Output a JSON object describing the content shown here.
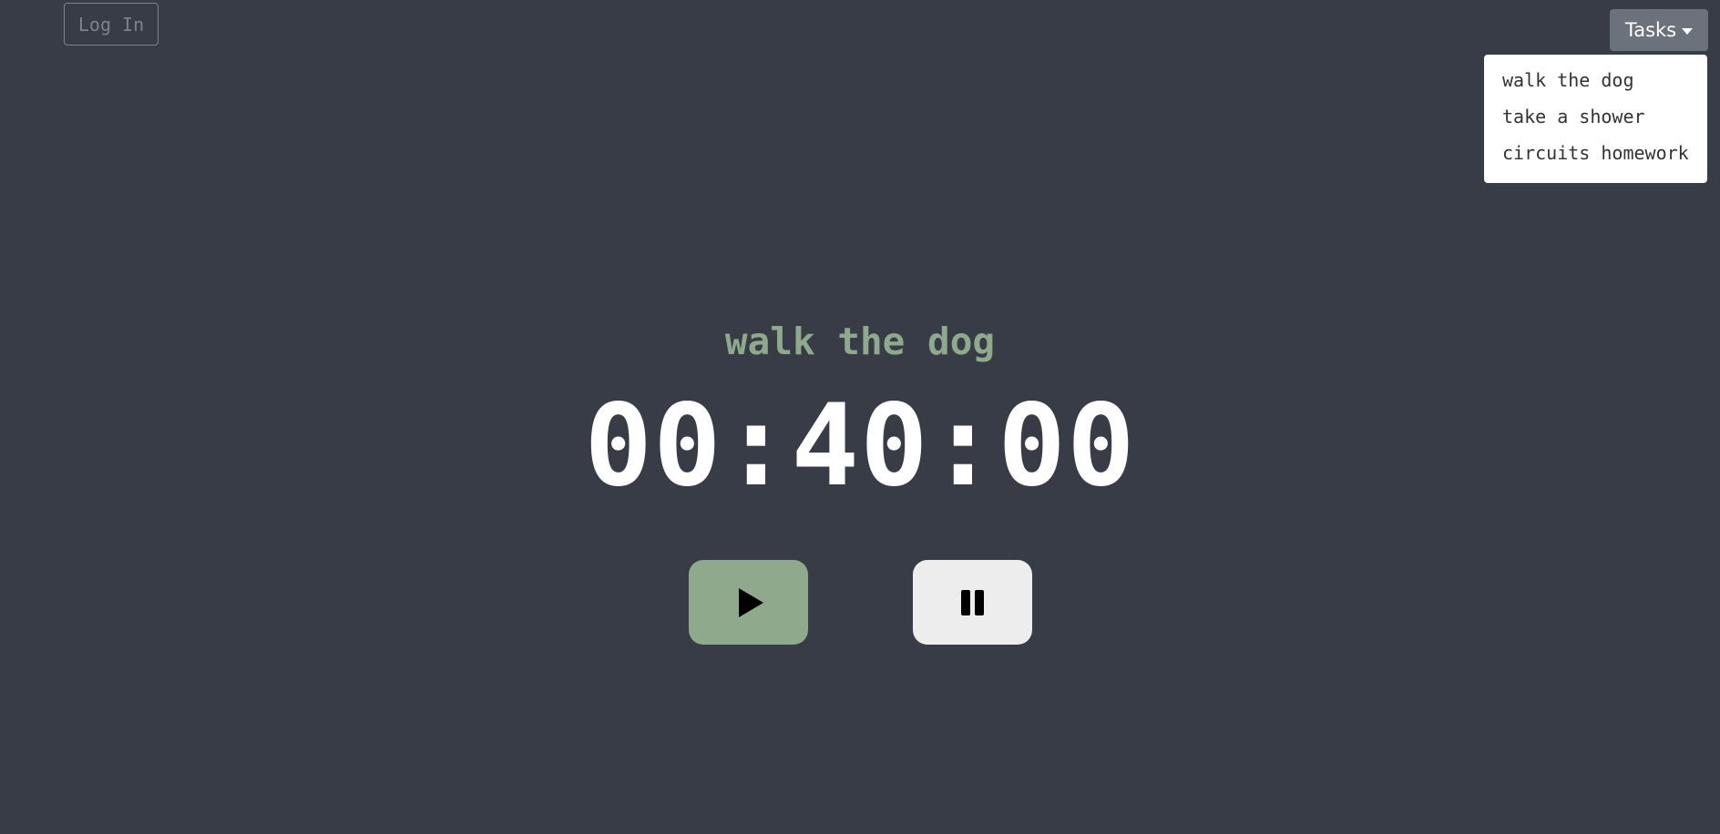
{
  "header": {
    "login_label": "Log In",
    "tasks_label": "Tasks"
  },
  "tasks_menu": {
    "items": [
      {
        "label": "walk the dog"
      },
      {
        "label": "take a shower"
      },
      {
        "label": "circuits homework"
      }
    ]
  },
  "timer": {
    "current_task": "walk the dog",
    "display": "00:40:00"
  },
  "controls": {
    "play_icon": "play-icon",
    "pause_icon": "pause-icon"
  },
  "colors": {
    "background": "#383c46",
    "accent_green": "#8fa98c",
    "tasks_button": "#6b727c",
    "pause_button": "#ededed"
  }
}
